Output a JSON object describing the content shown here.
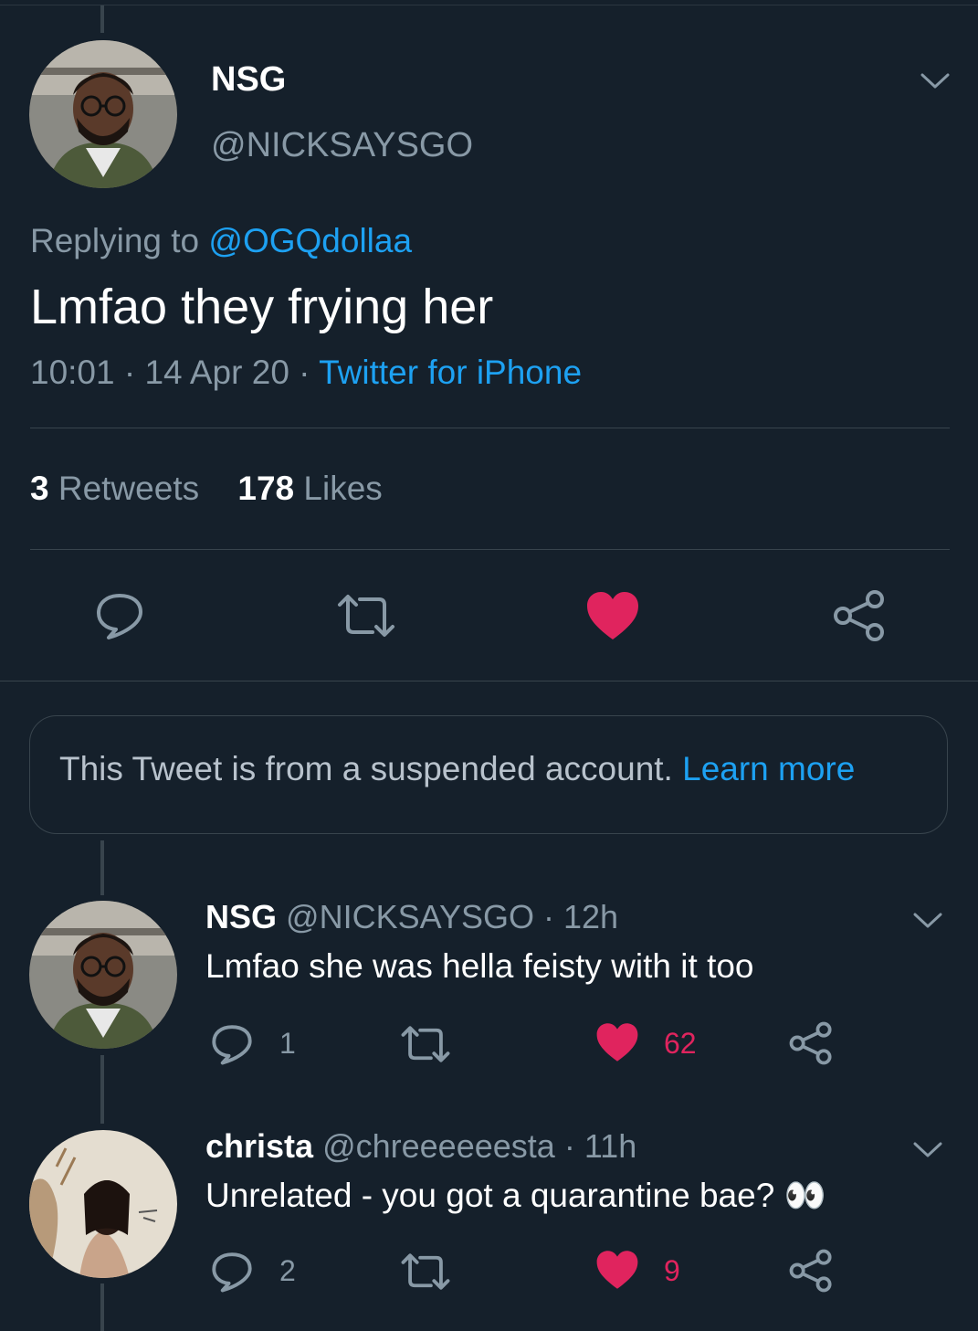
{
  "main_tweet": {
    "display_name": "NSG",
    "handle": "@NICKSAYSGO",
    "replying_prefix": "Replying to",
    "replying_to": "@OGQdollaa",
    "text": "Lmfao they frying her",
    "time": "10:01",
    "date": "14 Apr 20",
    "source": "Twitter for iPhone",
    "retweet_count": "3",
    "retweet_label": "Retweets",
    "like_count": "178",
    "like_label": "Likes",
    "liked": true
  },
  "suspended_notice": {
    "text": "This Tweet is from a suspended account.",
    "link": "Learn more"
  },
  "replies": [
    {
      "display_name": "NSG",
      "handle": "@NICKSAYSGO",
      "age": "12h",
      "text": "Lmfao she was hella feisty with it too",
      "reply_count": "1",
      "like_count": "62"
    },
    {
      "display_name": "christa",
      "handle": "@chreeeeeesta",
      "age": "11h",
      "text": "Unrelated - you got a quarantine bae?",
      "emoji": "👀",
      "reply_count": "2",
      "like_count": "9"
    }
  ],
  "separator": "·",
  "colors": {
    "background": "#15202b",
    "accent": "#1da1f2",
    "like": "#e0245e",
    "muted": "#8899a6",
    "border": "#38444d"
  }
}
